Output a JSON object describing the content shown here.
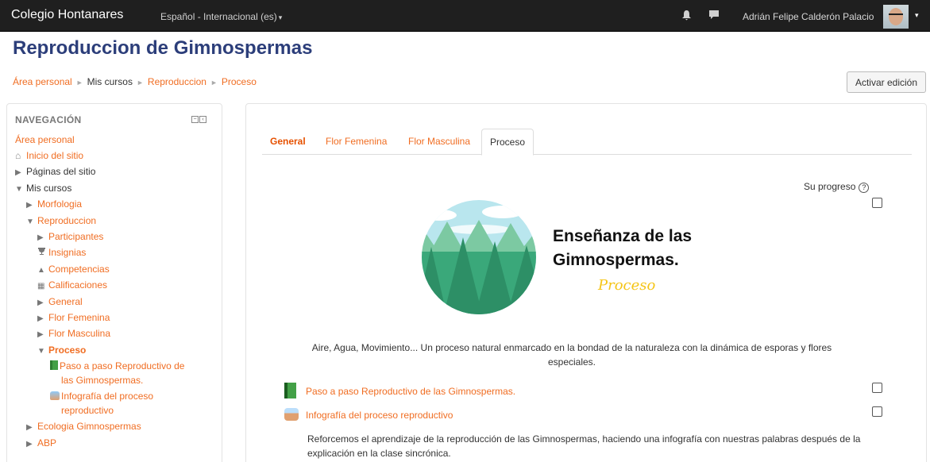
{
  "navbar": {
    "site_name": "Colegio Hontanares",
    "language": "Español - Internacional (es)",
    "caret": "▾",
    "user_name": "Adrián Felipe Calderón Palacio",
    "bell_glyph": "🔔",
    "message_glyph": "▬"
  },
  "page": {
    "title": "Reproduccion de Gimnospermas",
    "edit_button": "Activar edición"
  },
  "breadcrumb": [
    {
      "label": "Área personal",
      "link": true
    },
    {
      "label": "Mis cursos",
      "link": false
    },
    {
      "label": "Reproduccion",
      "link": true
    },
    {
      "label": "Proceso",
      "link": true
    }
  ],
  "breadcrumb_separator": "►",
  "navigation": {
    "header": "NAVEGACIÓN",
    "hide_glyph": "−",
    "dock_glyph": "‹",
    "items": {
      "area_personal": "Área personal",
      "inicio": "Inicio del sitio",
      "paginas": "Páginas del sitio",
      "mis_cursos": "Mis cursos",
      "morfologia": "Morfologia",
      "reproduccion": "Reproduccion",
      "participantes": "Participantes",
      "insignias": "Insignias",
      "competencias": "Competencias",
      "calificaciones": "Calificaciones",
      "general": "General",
      "flor_femenina": "Flor Femenina",
      "flor_masculina": "Flor Masculina",
      "proceso": "Proceso",
      "paso_a_paso_1": "Paso a paso Reproductivo de",
      "paso_a_paso_2": "las Gimnospermas.",
      "infografia_1": "Infografía del proceso",
      "infografia_2": "reproductivo",
      "ecologia": "Ecologia Gimnospermas",
      "abp": "ABP"
    },
    "glyphs": {
      "collapsed": "▶",
      "expanded": "▼",
      "home": "⌂",
      "trophy": "🏆",
      "competency": "▲",
      "grades": "▦"
    }
  },
  "tabs": [
    "General",
    "Flor Femenina",
    "Flor Masculina",
    "Proceso"
  ],
  "content": {
    "progress_label": "Su progreso",
    "help_glyph": "?",
    "banner_title_line1": "Enseñanza de las",
    "banner_title_line2": "Gimnospermas.",
    "banner_subtitle": "Proceso",
    "description": "Aire, Agua, Movimiento... Un proceso natural enmarcado en la bondad de la naturaleza con la dinámica de esporas y flores especiales.",
    "activities": [
      {
        "name": "Paso a paso Reproductivo de las Gimnospermas.",
        "icon": "book-icon"
      },
      {
        "name": "Infografía del proceso reproductivo",
        "icon": "assignment-icon"
      }
    ],
    "activity_description": "Reforcemos el aprendizaje de la reproducción de las Gimnospermas, haciendo una infografía con nuestras palabras después de la explicación en la clase sincrónica."
  },
  "colors": {
    "navbar_bg": "#1f1f1f",
    "link": "#f06d22",
    "title": "#2c3e7a",
    "banner_green": "#3aa87a",
    "banner_sky": "#b9e6ee",
    "subtitle_yellow": "#f5c518"
  }
}
